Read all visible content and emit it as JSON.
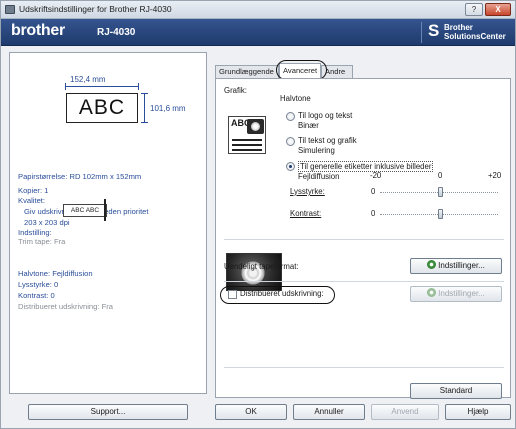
{
  "window": {
    "title": "Udskriftsindstillinger for Brother RJ-4030",
    "help_glyph": "?",
    "close_glyph": "X"
  },
  "brand": {
    "logo": "brother",
    "model": "RJ-4030",
    "solutions_line1": "Brother",
    "solutions_line2": "SolutionsCenter",
    "solutions_mark": "S"
  },
  "preview": {
    "width_label": "152,4 mm",
    "height_label": "101,6 mm",
    "sample_text": "ABC",
    "cut_sample": "ABC ABC"
  },
  "summary": {
    "paper_size": "Papirstørrelse: RD 102mm x 152mm",
    "copies": "Kopier: 1",
    "quality": "Kvalitet:",
    "quality_value": "Giv udskrivningshastigheden prioritet",
    "resolution": "203 x 203 dpi",
    "setting": "Indstilling:",
    "trim_tape": "Trim tape: Fra",
    "halftone": "Halvtone: Fejldiffusion",
    "brightness": "Lysstyrke:  0",
    "contrast": "Kontrast:  0",
    "distributed": "Distribueret udskrivning: Fra"
  },
  "tabs": [
    {
      "label": "Grundlæggende"
    },
    {
      "label": "Avanceret"
    },
    {
      "label": "Andre"
    }
  ],
  "advanced": {
    "graphic_label": "Grafik:",
    "halftone_label": "Halvtone",
    "options": [
      {
        "line1": "Til logo og tekst",
        "line2": "Binær",
        "selected": false
      },
      {
        "line1": "Til tekst og grafik",
        "line2": "Simulering",
        "selected": false
      },
      {
        "line1": "Til generelle etiketter inklusive billeder",
        "line2": "Fejldiffusion",
        "selected": true
      }
    ],
    "scale": {
      "min": "-20",
      "mid": "0",
      "max": "+20"
    },
    "brightness_label": "Lysstyrke:",
    "brightness_value": "0",
    "contrast_label": "Kontrast:",
    "contrast_value": "0",
    "tape_format_label": "Uendeligt tapeformat:",
    "settings_button": "Indstillinger...",
    "distributed_label": "Distribueret udskrivning:",
    "distributed_checked": false,
    "settings_button_2": "Indstillinger...",
    "default_button": "Standard"
  },
  "buttons": {
    "support": "Support...",
    "ok": "OK",
    "cancel": "Annuller",
    "apply": "Anvend",
    "help": "Hjælp"
  }
}
